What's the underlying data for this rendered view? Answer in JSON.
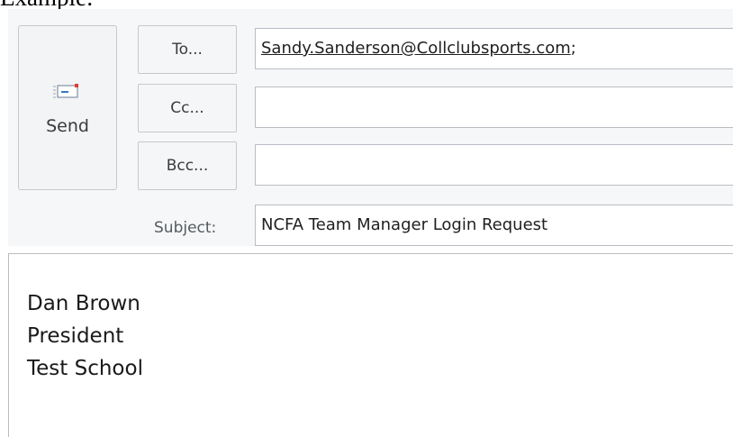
{
  "caption": "Example:",
  "send_button": {
    "label": "Send",
    "icon": "send-envelope-icon"
  },
  "recipients": {
    "to_button": "To...",
    "cc_button": "Cc...",
    "bcc_button": "Bcc...",
    "to_value": "Sandy.Sanderson@Collclubsports.com",
    "to_separator": ";",
    "cc_value": "",
    "bcc_value": ""
  },
  "subject": {
    "label": "Subject:",
    "value": "NCFA Team Manager Login Request"
  },
  "body": {
    "lines": [
      "Dan Brown",
      "President",
      "Test School"
    ]
  },
  "colors": {
    "header_bg": "#f6f7f8",
    "field_border": "#b9bdc3",
    "envelope_flag": "#e23b2e",
    "envelope_blue": "#3b78c4"
  }
}
